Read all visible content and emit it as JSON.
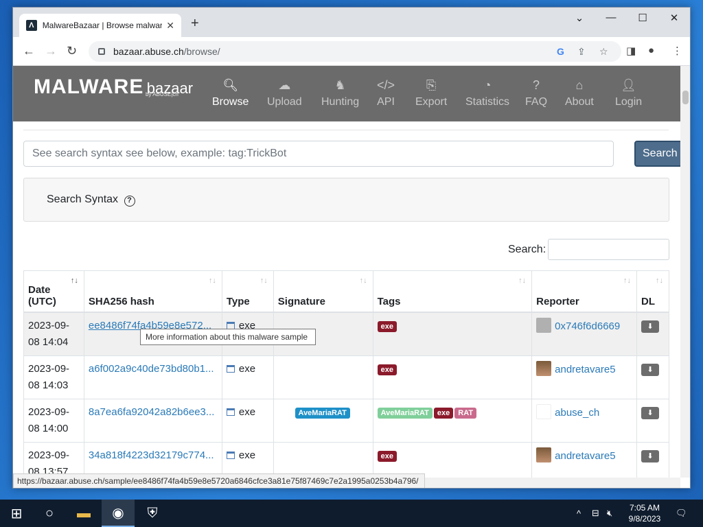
{
  "browser": {
    "tab_title": "MalwareBazaar | Browse malware",
    "url_host": "bazaar.abuse.ch",
    "url_path": "/browse/"
  },
  "site": {
    "logo_main": "MALWARE",
    "logo_sub": "bazaar",
    "logo_by": "by ABUSE|ch",
    "nav": [
      {
        "label": "Browse",
        "icon": "search-icon"
      },
      {
        "label": "Upload",
        "icon": "cloud-upload-icon"
      },
      {
        "label": "Hunting",
        "icon": "hunting-icon"
      },
      {
        "label": "API",
        "icon": "code-icon"
      },
      {
        "label": "Export",
        "icon": "export-icon"
      },
      {
        "label": "Statistics",
        "icon": "pie-chart-icon"
      },
      {
        "label": "FAQ",
        "icon": "question-icon"
      },
      {
        "label": "About",
        "icon": "building-icon"
      },
      {
        "label": "Login",
        "icon": "user-icon"
      }
    ]
  },
  "search": {
    "placeholder": "See search syntax see below, example: tag:TrickBot",
    "button": "Search",
    "syntax_label": "Search Syntax",
    "table_search_label": "Search:"
  },
  "table": {
    "headers": {
      "date": "Date (UTC)",
      "hash": "SHA256 hash",
      "type": "Type",
      "signature": "Signature",
      "tags": "Tags",
      "reporter": "Reporter",
      "dl": "DL"
    },
    "rows": [
      {
        "date": "2023-09-08 14:04",
        "hash": "ee8486f74fa4b59e8e572...",
        "type": "exe",
        "signature": "",
        "tags": [
          "exe"
        ],
        "reporter": "0x746f6d6669"
      },
      {
        "date": "2023-09-08 14:03",
        "hash": "a6f002a9c40de73bd80b1...",
        "type": "exe",
        "signature": "",
        "tags": [
          "exe"
        ],
        "reporter": "andretavare5"
      },
      {
        "date": "2023-09-08 14:00",
        "hash": "8a7ea6fa92042a82b6ee3...",
        "type": "exe",
        "signature": "AveMariaRAT",
        "tags": [
          "AveMariaRAT",
          "exe",
          "RAT"
        ],
        "reporter": "abuse_ch"
      },
      {
        "date": "2023-09-08 13:57",
        "hash": "34a818f4223d32179c774...",
        "type": "exe",
        "signature": "",
        "tags": [
          "exe"
        ],
        "reporter": "andretavare5"
      }
    ]
  },
  "tooltip": "More information about this malware sample",
  "status_url": "https://bazaar.abuse.ch/sample/ee8486f74fa4b59e8e5720a6846cfce3a81e75f87469c7e2a1995a0253b4a796/",
  "taskbar": {
    "time": "7:05 AM",
    "date": "9/8/2023"
  },
  "colors": {
    "header_bg": "#6b6b6b",
    "link": "#2a7ab8",
    "exe_badge": "#8b1a2b",
    "signature_badge": "#1e90c8"
  }
}
